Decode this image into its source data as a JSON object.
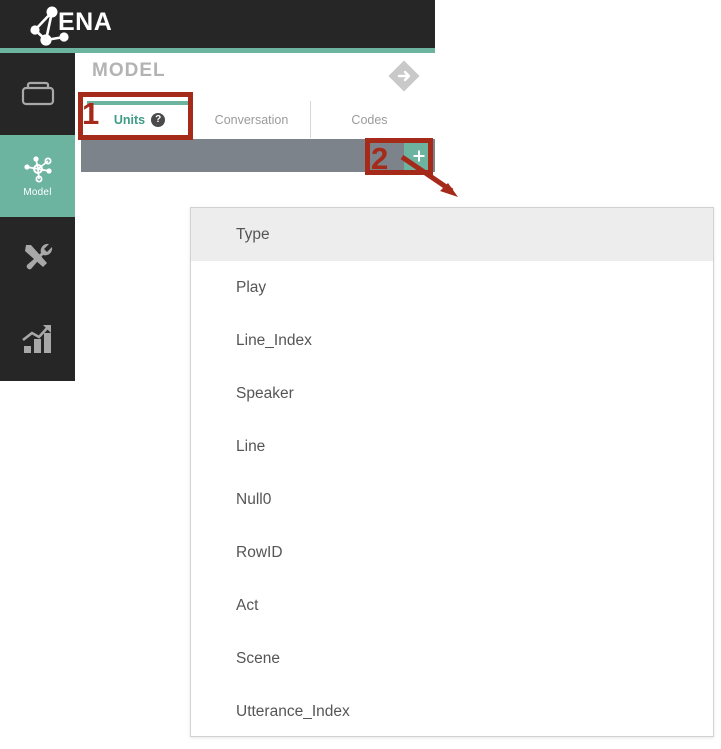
{
  "app": {
    "name": "ENA",
    "logo_icon": "network-graph-icon"
  },
  "sidebar": {
    "items": [
      {
        "label": "",
        "icon": "data-box-icon",
        "active": false
      },
      {
        "label": "Model",
        "icon": "network-nodes-icon",
        "active": true
      },
      {
        "label": "",
        "icon": "tools-icon",
        "active": false
      },
      {
        "label": "",
        "icon": "bar-chart-trend-icon",
        "active": false
      }
    ]
  },
  "panel": {
    "title": "MODEL",
    "forward_icon": "diamond-arrow-right-icon"
  },
  "tabs": [
    {
      "label": "Units",
      "active": true,
      "help_icon": "question-mark-icon",
      "help_glyph": "?"
    },
    {
      "label": "Conversation",
      "active": false
    },
    {
      "label": "Codes",
      "active": false
    }
  ],
  "toolbar": {
    "add_label": "+",
    "add_icon": "plus-icon"
  },
  "dropdown": {
    "items": [
      {
        "label": "Type",
        "highlighted": true
      },
      {
        "label": "Play",
        "highlighted": false
      },
      {
        "label": "Line_Index",
        "highlighted": false
      },
      {
        "label": "Speaker",
        "highlighted": false
      },
      {
        "label": "Line",
        "highlighted": false
      },
      {
        "label": "Null0",
        "highlighted": false
      },
      {
        "label": "RowID",
        "highlighted": false
      },
      {
        "label": "Act",
        "highlighted": false
      },
      {
        "label": "Scene",
        "highlighted": false
      },
      {
        "label": "Utterance_Index",
        "highlighted": false
      }
    ]
  },
  "annotations": [
    {
      "number": "1",
      "target": "units-tab"
    },
    {
      "number": "2",
      "target": "add-unit-button"
    }
  ],
  "colors": {
    "accent_teal": "#6cb3a0",
    "dark_chrome": "#262626",
    "toolbar_gray": "#7d838b",
    "annotation_red": "#a52a1a",
    "title_gray": "#b3b3b3",
    "highlight_gray": "#ededed"
  }
}
